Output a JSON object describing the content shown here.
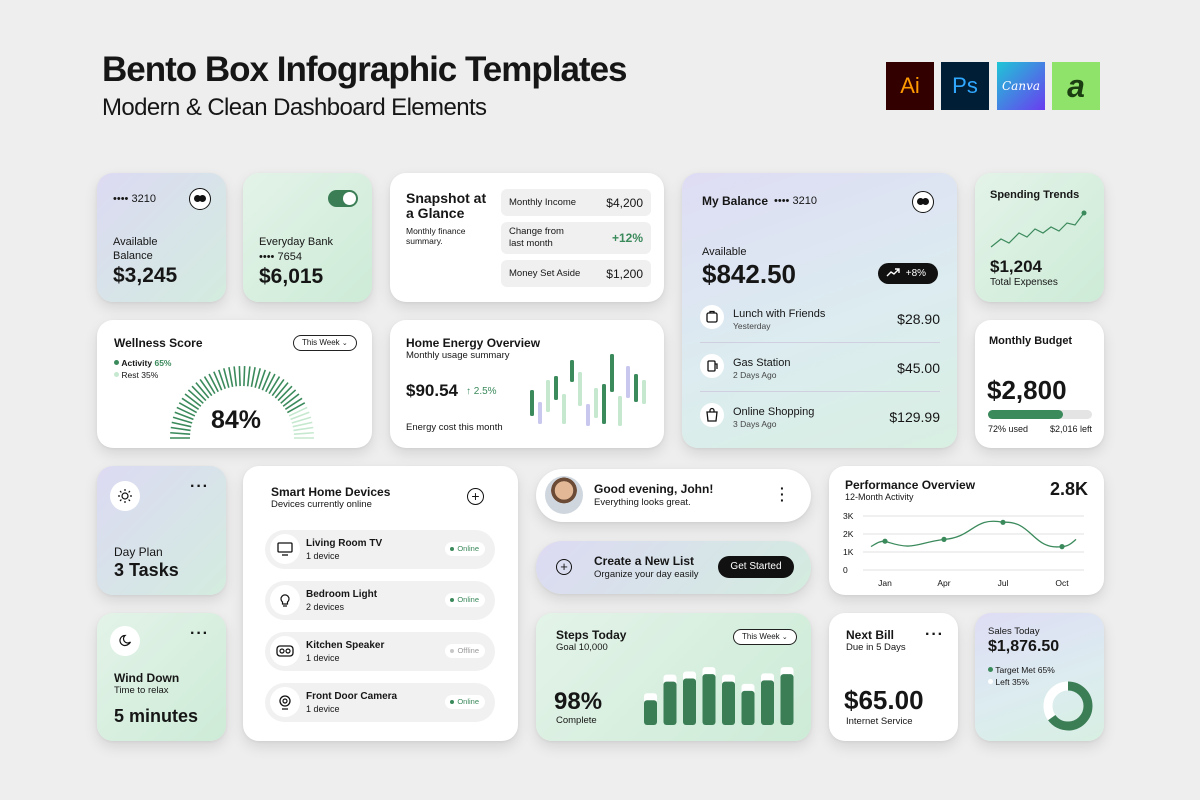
{
  "header": {
    "title": "Bento Box Infographic Templates",
    "subtitle": "Modern & Clean Dashboard Elements",
    "apps": [
      {
        "label": "Ai",
        "bg": "#330000",
        "fg": "#ff9a00"
      },
      {
        "label": "Ps",
        "bg": "#001e36",
        "fg": "#31a8ff"
      },
      {
        "label": "Canva",
        "bg": "#6a3cf0",
        "fg": "#ffffff"
      },
      {
        "label": "a",
        "bg": "#8fe36a",
        "fg": "#1b3d12"
      }
    ]
  },
  "colors": {
    "accent": "#3b8a5c",
    "light_accent": "#c5e8cf",
    "lavender": "#c9c7ee"
  },
  "available_card": {
    "card_mask": "•••• 3210",
    "label": "Available Balance",
    "amount": "$3,245"
  },
  "everyday_card": {
    "label": "Everyday Bank",
    "card_mask": "•••• 7654",
    "amount": "$6,015"
  },
  "snapshot": {
    "title": "Snapshot at a Glance",
    "desc": "Monthly finance summary.",
    "rows": [
      {
        "label": "Monthly Income",
        "value": "$4,200"
      },
      {
        "label": "Change from last month",
        "value": "+12%"
      },
      {
        "label": "Money Set Aside",
        "value": "$1,200"
      }
    ]
  },
  "my_balance": {
    "title": "My Balance",
    "card_mask": "•••• 3210",
    "available_label": "Available",
    "amount": "$842.50",
    "change": "+8%",
    "transactions": [
      {
        "icon": "bag-icon",
        "name": "Lunch with Friends",
        "when": "Yesterday",
        "amount": "$28.90"
      },
      {
        "icon": "fuel-icon",
        "name": "Gas Station",
        "when": "2 Days Ago",
        "amount": "$45.00"
      },
      {
        "icon": "shopping-bag-icon",
        "name": "Online Shopping",
        "when": "3 Days Ago",
        "amount": "$129.99"
      }
    ]
  },
  "spending": {
    "title": "Spending Trends",
    "amount": "$1,204",
    "label": "Total Expenses"
  },
  "wellness": {
    "title": "Wellness Score",
    "week_label": "This Week",
    "activity_label": "Activity",
    "activity_value": "65%",
    "rest_label": "Rest",
    "rest_value": "35%",
    "score": "84%",
    "score_fraction": 0.84
  },
  "energy": {
    "title": "Home Energy Overview",
    "subtitle": "Monthly usage summary",
    "amount": "$90.54",
    "change": "2.5%",
    "footer": "Energy cost this month"
  },
  "monthly_budget": {
    "title": "Monthly Budget",
    "amount": "$2,800",
    "used": "72% used",
    "left": "$2,016 left",
    "used_fraction": 0.72
  },
  "day_plan": {
    "label": "Day Plan",
    "value": "3 Tasks"
  },
  "smart_home": {
    "title": "Smart Home Devices",
    "subtitle": "Devices currently online",
    "devices": [
      {
        "icon": "tv-icon",
        "name": "Living Room TV",
        "count": "1 device",
        "status": "Online",
        "online": true
      },
      {
        "icon": "lightbulb-icon",
        "name": "Bedroom Light",
        "count": "2 devices",
        "status": "Online",
        "online": true
      },
      {
        "icon": "speaker-icon",
        "name": "Kitchen Speaker",
        "count": "1 device",
        "status": "Offline",
        "online": false
      },
      {
        "icon": "camera-icon",
        "name": "Front Door Camera",
        "count": "1 device",
        "status": "Online",
        "online": true
      }
    ]
  },
  "greeting": {
    "title": "Good evening, John!",
    "subtitle": "Everything looks great."
  },
  "new_list": {
    "title": "Create a New List",
    "subtitle": "Organize your day easily",
    "button": "Get Started"
  },
  "performance": {
    "title": "Performance Overview",
    "subtitle": "12-Month Activity",
    "total": "2.8K"
  },
  "chart_data": {
    "type": "line",
    "title": "Performance Overview",
    "x": [
      "Jan",
      "Apr",
      "Jul",
      "Oct"
    ],
    "y_ticks": [
      "3K",
      "2K",
      "1K",
      "0"
    ],
    "ylim": [
      0,
      3000
    ],
    "series": [
      {
        "values": [
          1600,
          1700,
          2650,
          1300
        ]
      }
    ]
  },
  "wind_down": {
    "title": "Wind Down",
    "subtitle": "Time to relax",
    "value": "5 minutes"
  },
  "steps": {
    "title": "Steps Today",
    "goal": "Goal 10,000",
    "week_label": "This Week",
    "percent": "98%",
    "complete_label": "Complete",
    "bars": [
      0.4,
      0.7,
      0.75,
      0.82,
      0.7,
      0.55,
      0.72,
      0.82
    ]
  },
  "next_bill": {
    "title": "Next Bill",
    "due": "Due in 5 Days",
    "amount": "$65.00",
    "service": "Internet Service"
  },
  "sales": {
    "title": "Sales Today",
    "amount": "$1,876.50",
    "target_label": "Target Met",
    "target_value": "65%",
    "left_label": "Left",
    "left_value": "35%",
    "target_fraction": 0.65
  }
}
